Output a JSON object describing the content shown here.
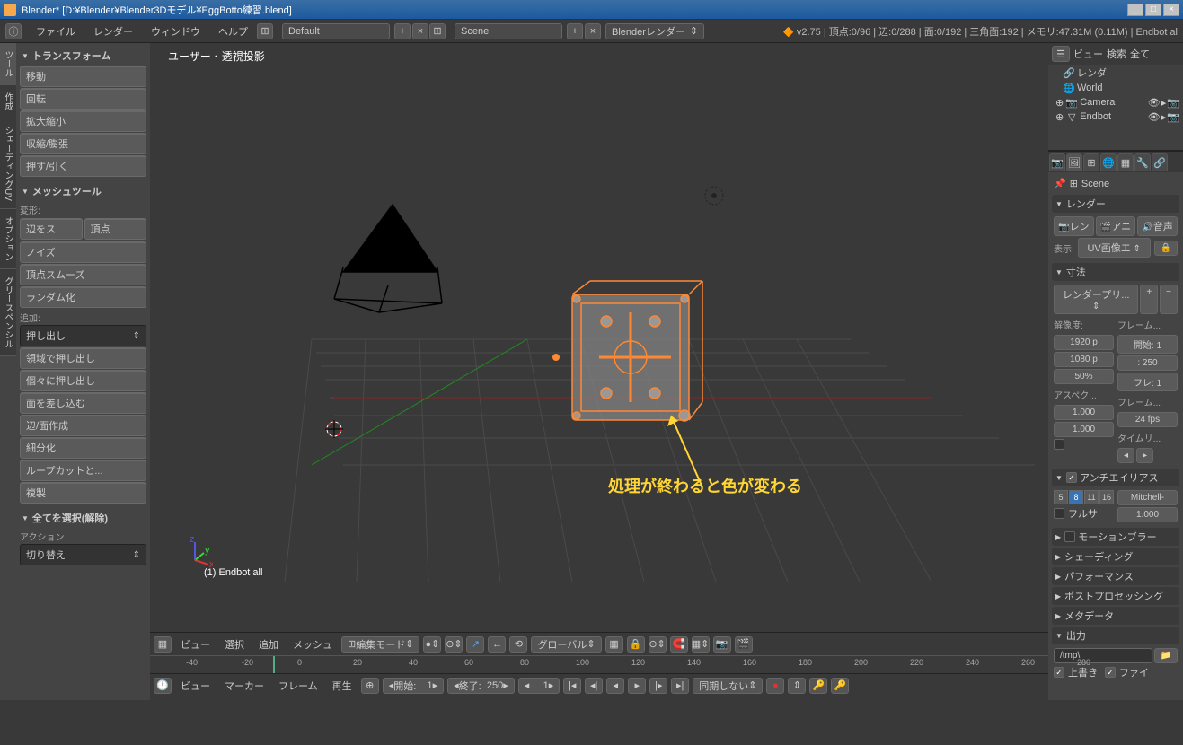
{
  "titlebar": {
    "title": "Blender* [D:¥Blender¥Blender3Dモデル¥EggBotto練習.blend]"
  },
  "topbar": {
    "menus": [
      "ファイル",
      "レンダー",
      "ウィンドウ",
      "ヘルプ"
    ],
    "layout": "Default",
    "scene": "Scene",
    "engine": "Blenderレンダー",
    "stats": "v2.75 | 頂点:0/96 | 辺:0/288 | 面:0/192 | 三角面:192 | メモリ:47.31M (0.11M) | Endbot al"
  },
  "tool_tabs": [
    "ツール",
    "作成",
    "シェーディングUV",
    "オプション",
    "グリースペンシル"
  ],
  "tool_panel": {
    "transform_header": "トランスフォーム",
    "transform_buttons": [
      "移動",
      "回転",
      "拡大縮小",
      "収縮/膨張",
      "押す/引く"
    ],
    "mesh_header": "メッシュツール",
    "deform_label": "変形:",
    "deform_row1": [
      "辺をス",
      "頂点"
    ],
    "deform_buttons": [
      "ノイズ",
      "頂点スムーズ",
      "ランダム化"
    ],
    "add_label": "追加:",
    "add_select": "押し出し",
    "add_buttons": [
      "領域で押し出し",
      "個々に押し出し",
      "面を差し込む",
      "辺/面作成",
      "細分化",
      "ループカットと...",
      "複製"
    ],
    "history_header": "全てを選択(解除)",
    "action_label": "アクション",
    "action_select": "切り替え"
  },
  "viewport": {
    "label": "ユーザー・透視投影",
    "object_name": "(1) Endbot all",
    "annotation": "処理が終わると色が変わる"
  },
  "viewport_header": {
    "menus": [
      "ビュー",
      "選択",
      "追加",
      "メッシュ"
    ],
    "mode": "編集モード",
    "orientation": "グローバル"
  },
  "timeline": {
    "ticks": [
      -40,
      -20,
      0,
      20,
      40,
      60,
      80,
      100,
      120,
      140,
      160,
      180,
      200,
      220,
      240,
      260,
      280
    ],
    "menus": [
      "ビュー",
      "マーカー",
      "フレーム",
      "再生"
    ],
    "start_label": "開始:",
    "start": "1",
    "end_label": "終了:",
    "end": "250",
    "current": "1",
    "sync": "同期しない",
    "current_frame": 1
  },
  "outliner": {
    "header_view": "ビュー",
    "header_search": "検索",
    "header_all": "全て",
    "items": [
      {
        "label": "レンダ",
        "icon": "🔗"
      },
      {
        "label": "World",
        "icon": "🌐"
      },
      {
        "label": "Camera",
        "icon": "📷"
      },
      {
        "label": "Endbot",
        "icon": "▽"
      }
    ]
  },
  "props": {
    "breadcrumb": "Scene",
    "render_header": "レンダー",
    "render_buttons": [
      "レン",
      "アニ",
      "音声"
    ],
    "display_label": "表示:",
    "display_value": "UV画像エ",
    "dimensions_header": "寸法",
    "preset": "レンダープリ...",
    "resolution_label": "解像度:",
    "resolution_x": "1920 p",
    "resolution_y": "1080 p",
    "resolution_pct": "50%",
    "frame_label": "フレーム...",
    "frame_start": "開始: 1",
    "frame_end": ": 250",
    "frame_step": "フレ: 1",
    "aspect_label": "アスペク...",
    "aspect_x": "1.000",
    "aspect_y": "1.000",
    "framerate_label": "フレーム...",
    "framerate": "24 fps",
    "timeremap_label": "タイムリ...",
    "aa_header": "アンチエイリアス",
    "aa_samples": [
      "5",
      "8",
      "11",
      "16"
    ],
    "aa_filter": "Mitchell-",
    "aa_fullsample": "フルサ",
    "aa_size": "1.000",
    "sections_closed": [
      "モーションブラー",
      "シェーディング",
      "パフォーマンス",
      "ポストプロセッシング",
      "メタデータ"
    ],
    "output_header": "出力",
    "output_path": "/tmp\\",
    "output_overwrite": "上書き",
    "output_file": "ファイ"
  }
}
